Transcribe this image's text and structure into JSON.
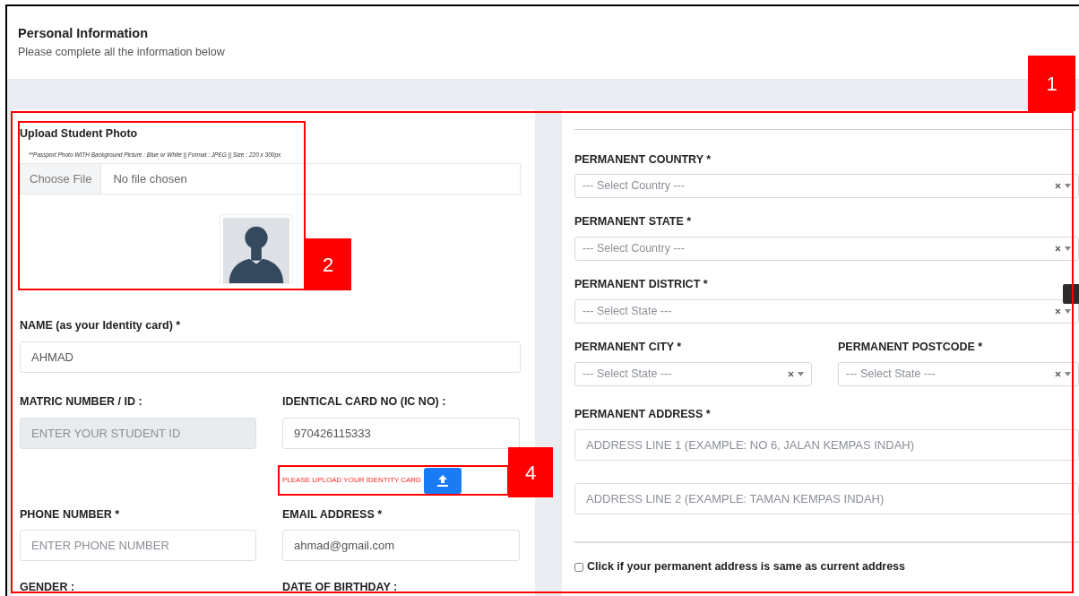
{
  "header": {
    "title": "Personal Information",
    "subtitle": "Please complete all the information below"
  },
  "photo": {
    "title": "Upload Student Photo",
    "hint": "**Passport Photo WITH Background Picture : Blue or White || Format : JPEG || Size : 220 x 300px",
    "button": "Choose File",
    "status": "No file chosen"
  },
  "name": {
    "label": "NAME (as your Identity card) *",
    "value": "AHMAD"
  },
  "matric": {
    "label": "MATRIC NUMBER / ID :",
    "placeholder": "ENTER YOUR STUDENT ID",
    "disabled": true
  },
  "ic": {
    "label": "IDENTICAL CARD NO (IC NO) :",
    "value": "970426115333",
    "warning": "PLEASE UPLOAD YOUR IDENTITY CARD"
  },
  "phone": {
    "label": "PHONE NUMBER *",
    "placeholder": "ENTER PHONE NUMBER"
  },
  "email": {
    "label": "EMAIL ADDRESS *",
    "value": "ahmad@gmail.com"
  },
  "cut_labels": [
    "GENDER :",
    "DATE OF BIRTHDAY :"
  ],
  "selects": [
    {
      "label": "PERMANENT COUNTRY *",
      "placeholder": "--- Select Country ---"
    },
    {
      "label": "PERMANENT STATE *",
      "placeholder": "--- Select Country ---"
    },
    {
      "label": "PERMANENT DISTRICT *",
      "placeholder": "--- Select State ---"
    }
  ],
  "city": {
    "label": "PERMANENT CITY *",
    "placeholder": "--- Select State ---"
  },
  "postcode": {
    "label": "PERMANENT POSTCODE *",
    "placeholder": "--- Select State ---"
  },
  "address": {
    "label": "PERMANENT ADDRESS *",
    "placeholders": [
      "ADDRESS LINE 1 (EXAMPLE: NO 6, JALAN KEMPAS INDAH)",
      "ADDRESS LINE 2 (EXAMPLE: TAMAN KEMPAS INDAH)"
    ]
  },
  "same_address": {
    "label": "Click if your permanent address is same as current address",
    "checked": false
  },
  "annotations": [
    "1",
    "2",
    "4"
  ]
}
